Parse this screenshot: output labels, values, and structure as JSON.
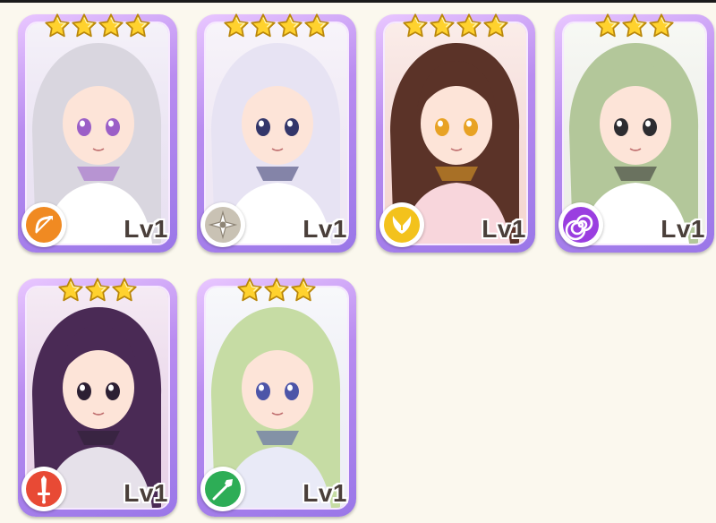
{
  "cards": [
    {
      "name": "card-1",
      "stars": 4,
      "level_label": "Lv1",
      "element": "archer",
      "element_icon": "bow-icon",
      "element_color": "#f08a22",
      "palette": {
        "bg": "#e9e2f2",
        "hair": "#d9d6df",
        "accent": "#9b5fc7",
        "outfit": "#ffffff"
      }
    },
    {
      "name": "card-2",
      "stars": 4,
      "level_label": "Lv1",
      "element": "light-star",
      "element_icon": "compass-star-icon",
      "element_color": "#c9c2b4",
      "palette": {
        "bg": "#efe8f4",
        "hair": "#e7e3f3",
        "accent": "#33366a",
        "outfit": "#ffffff"
      }
    },
    {
      "name": "card-3",
      "stars": 4,
      "level_label": "Lv1",
      "element": "holy",
      "element_icon": "wings-icon",
      "element_color": "#f3c21c",
      "palette": {
        "bg": "#f6d7cf",
        "hair": "#5b3328",
        "accent": "#e8a224",
        "outfit": "#f8d6dc"
      }
    },
    {
      "name": "card-4",
      "stars": 3,
      "level_label": "Lv1",
      "element": "void",
      "element_icon": "spiral-icon",
      "element_color": "#9a3ee0",
      "palette": {
        "bg": "#eef1e7",
        "hair": "#b3c79a",
        "accent": "#2d2c30",
        "outfit": "#ffffff"
      }
    },
    {
      "name": "card-5",
      "stars": 3,
      "level_label": "Lv1",
      "element": "fire",
      "element_icon": "sword-icon",
      "element_color": "#e84a35",
      "palette": {
        "bg": "#e9d2e7",
        "hair": "#4a2a55",
        "accent": "#2c1f33",
        "outfit": "#e6e1ea"
      }
    },
    {
      "name": "card-6",
      "stars": 3,
      "level_label": "Lv1",
      "element": "wind",
      "element_icon": "spear-icon",
      "element_color": "#2dad56",
      "palette": {
        "bg": "#eef0f6",
        "hair": "#c6dca4",
        "accent": "#4d55a8",
        "outfit": "#e9eaf7"
      }
    }
  ]
}
